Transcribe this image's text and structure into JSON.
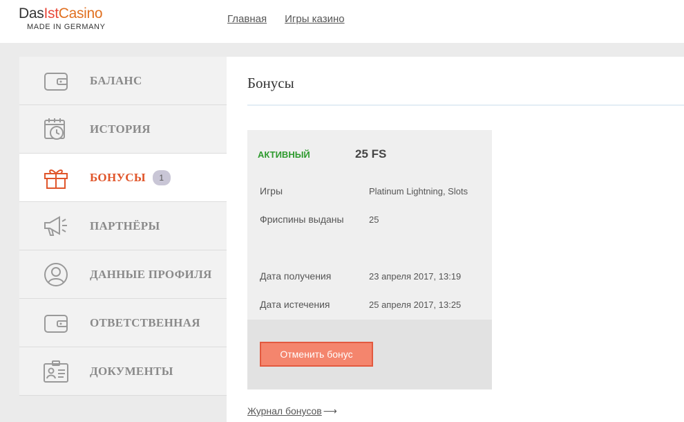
{
  "logo": {
    "part1": "Das",
    "part2": "Ist",
    "part3": "Casino",
    "tagline": "MADE IN GERMANY"
  },
  "nav": {
    "home": "Главная",
    "games": "Игры казино"
  },
  "sidebar": {
    "items": [
      {
        "label": "БАЛАНС",
        "icon": "wallet-icon"
      },
      {
        "label": "ИСТОРИЯ",
        "icon": "calendar-clock-icon"
      },
      {
        "label": "БОНУСЫ",
        "icon": "gift-icon",
        "badge": "1",
        "active": true
      },
      {
        "label": "ПАРТНЁРЫ",
        "icon": "megaphone-icon"
      },
      {
        "label": "ДАННЫЕ ПРОФИЛЯ",
        "icon": "user-circle-icon"
      },
      {
        "label": "ОТВЕТСТВЕННАЯ",
        "icon": "wallet-icon"
      },
      {
        "label": "ДОКУМЕНТЫ",
        "icon": "id-card-icon"
      }
    ]
  },
  "main": {
    "title": "Бонусы",
    "bonus": {
      "status": "АКТИВНЫЙ",
      "amount": "25 FS",
      "rows": [
        {
          "label": "Игры",
          "value": "Platinum Lightning, Slots"
        },
        {
          "label": "Фриспины выданы",
          "value": "25"
        },
        {
          "label": "Дата получения",
          "value": "23 апреля 2017, 13:19"
        },
        {
          "label": "Дата истечения",
          "value": "25 апреля 2017, 13:25"
        }
      ],
      "cancel_label": "Отменить бонус"
    },
    "journal_link": "Журнал бонусов"
  },
  "colors": {
    "accent": "#e0552a",
    "active_status": "#2e9a2e",
    "cancel_button": "#f4856d"
  }
}
